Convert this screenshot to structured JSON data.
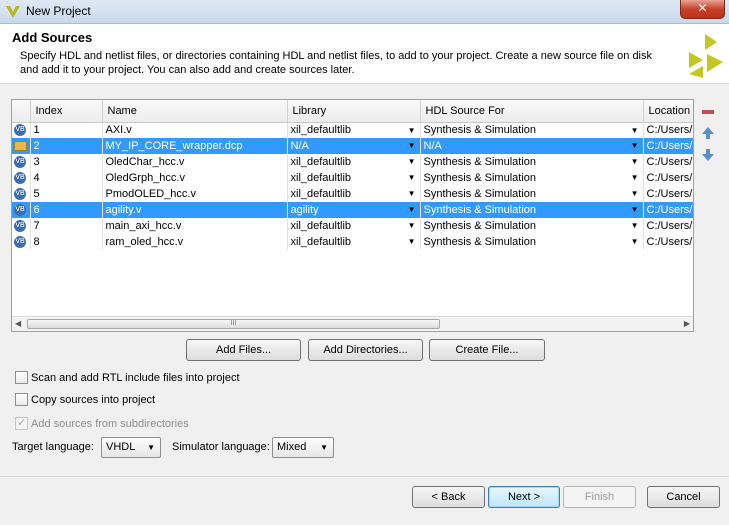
{
  "window": {
    "title": "New Project",
    "close_label": "✕"
  },
  "header": {
    "heading": "Add Sources",
    "description": "Specify HDL and netlist files, or directories containing HDL and netlist files, to add to your project. Create a new source file on disk and add it to your project. You can also add and create sources later."
  },
  "table": {
    "columns": [
      "",
      "Index",
      "Name",
      "Library",
      "HDL Source For",
      "Location"
    ],
    "rows": [
      {
        "icon": "vhdl-file-icon",
        "index": "1",
        "name": "AXI.v",
        "library": "xil_defaultlib",
        "source_for": "Synthesis & Simulation",
        "location": "C:/Users/G",
        "selected": false
      },
      {
        "icon": "folder-icon",
        "index": "2",
        "name": "MY_IP_CORE_wrapper.dcp",
        "library": "N/A",
        "source_for": "N/A",
        "location": "C:/Users/G",
        "selected": true
      },
      {
        "icon": "vhdl-file-icon",
        "index": "3",
        "name": "OledChar_hcc.v",
        "library": "xil_defaultlib",
        "source_for": "Synthesis & Simulation",
        "location": "C:/Users/G",
        "selected": false
      },
      {
        "icon": "vhdl-file-icon",
        "index": "4",
        "name": "OledGrph_hcc.v",
        "library": "xil_defaultlib",
        "source_for": "Synthesis & Simulation",
        "location": "C:/Users/G",
        "selected": false
      },
      {
        "icon": "vhdl-file-icon",
        "index": "5",
        "name": "PmodOLED_hcc.v",
        "library": "xil_defaultlib",
        "source_for": "Synthesis & Simulation",
        "location": "C:/Users/G",
        "selected": false
      },
      {
        "icon": "vhdl-file-icon",
        "index": "6",
        "name": "agility.v",
        "library": "agility",
        "source_for": "Synthesis & Simulation",
        "location": "C:/Users/G",
        "selected": true
      },
      {
        "icon": "vhdl-file-icon",
        "index": "7",
        "name": "main_axi_hcc.v",
        "library": "xil_defaultlib",
        "source_for": "Synthesis & Simulation",
        "location": "C:/Users/G",
        "selected": false
      },
      {
        "icon": "vhdl-file-icon",
        "index": "8",
        "name": "ram_oled_hcc.v",
        "library": "xil_defaultlib",
        "source_for": "Synthesis & Simulation",
        "location": "C:/Users/G",
        "selected": false
      }
    ],
    "scroll_thumb_grip": "III"
  },
  "buttons": {
    "add_files": "Add Files...",
    "add_directories": "Add Directories...",
    "create_file": "Create File...",
    "back": "< Back",
    "next": "Next >",
    "finish": "Finish",
    "cancel": "Cancel"
  },
  "options": {
    "scan_rtl": "Scan and add RTL include files into project",
    "copy_sources": "Copy sources into project",
    "add_subdirs": "Add sources from subdirectories"
  },
  "language": {
    "target_label": "Target language:",
    "target_value": "VHDL",
    "simulator_label": "Simulator language:",
    "simulator_value": "Mixed"
  },
  "colors": {
    "selection": "#3399ff",
    "remove": "#c0504d",
    "move": "#5b8fc9",
    "logo": "#c5c61f"
  }
}
